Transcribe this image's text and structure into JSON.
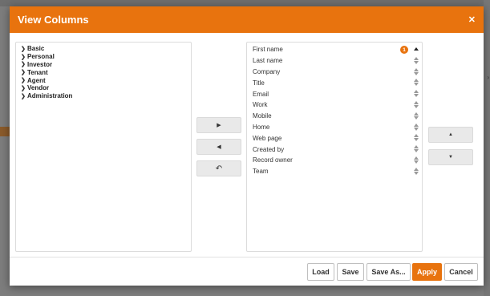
{
  "dialog": {
    "title": "View Columns",
    "close_glyph": "✕"
  },
  "tree": {
    "items": [
      {
        "label": "Basic"
      },
      {
        "label": "Personal"
      },
      {
        "label": "Investor"
      },
      {
        "label": "Tenant"
      },
      {
        "label": "Agent"
      },
      {
        "label": "Vendor"
      },
      {
        "label": "Administration"
      }
    ]
  },
  "transfer_buttons": {
    "add_icon": "chevron-right-icon",
    "remove_icon": "chevron-left-icon",
    "reset_icon": "undo-icon"
  },
  "selected_columns": {
    "items": [
      {
        "label": "First name",
        "badge": "1"
      },
      {
        "label": "Last name"
      },
      {
        "label": "Company"
      },
      {
        "label": "Title"
      },
      {
        "label": "Email"
      },
      {
        "label": "Work"
      },
      {
        "label": "Mobile"
      },
      {
        "label": "Home"
      },
      {
        "label": "Web page"
      },
      {
        "label": "Created by"
      },
      {
        "label": "Record owner"
      },
      {
        "label": "Team"
      }
    ]
  },
  "order_buttons": {
    "up_icon": "triangle-up-icon",
    "down_icon": "triangle-down-icon"
  },
  "footer": {
    "load": "Load",
    "save": "Save",
    "save_as": "Save As...",
    "apply": "Apply",
    "cancel": "Cancel"
  },
  "colors": {
    "accent": "#e8730e"
  }
}
